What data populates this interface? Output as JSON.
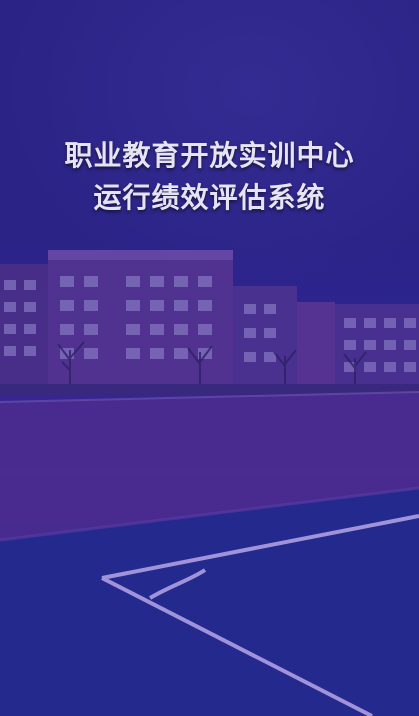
{
  "title": {
    "line1": "职业教育开放实训中心",
    "line2": "运行绩效评估系统"
  },
  "colors": {
    "overlay": "#2b2385",
    "title_text": "#e6e3f2",
    "track": "#4a2b8f",
    "field": "#23298d",
    "field_line": "#b7a6e8"
  }
}
